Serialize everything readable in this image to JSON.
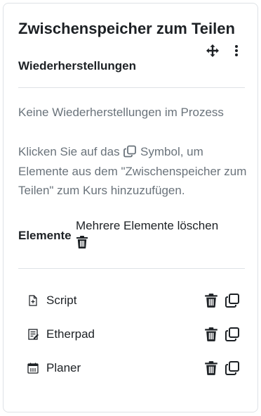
{
  "block": {
    "title": "Zwischenspeicher zum Teilen",
    "move_icon": "move-icon",
    "menu_icon": "kebab-menu-icon"
  },
  "restores": {
    "heading": "Wiederherstellungen",
    "empty_text": "Keine Wiederherstellungen im Prozess"
  },
  "help": {
    "before": "Klicken Sie auf das",
    "icon": "copy-icon",
    "after": " Symbol, um Elemente aus dem \"Zwischenspeicher zum Teilen\" zum Kurs hinzuzufügen."
  },
  "elements": {
    "heading": "Elemente",
    "delete_multiple": "Mehrere Elemente löschen",
    "items": [
      {
        "label": "Script",
        "icon": "file-script-icon"
      },
      {
        "label": "Etherpad",
        "icon": "etherpad-icon"
      },
      {
        "label": "Planer",
        "icon": "planner-icon"
      }
    ]
  },
  "colors": {
    "text": "#1d2125",
    "muted": "#6a737b",
    "border": "#dee2e6"
  }
}
